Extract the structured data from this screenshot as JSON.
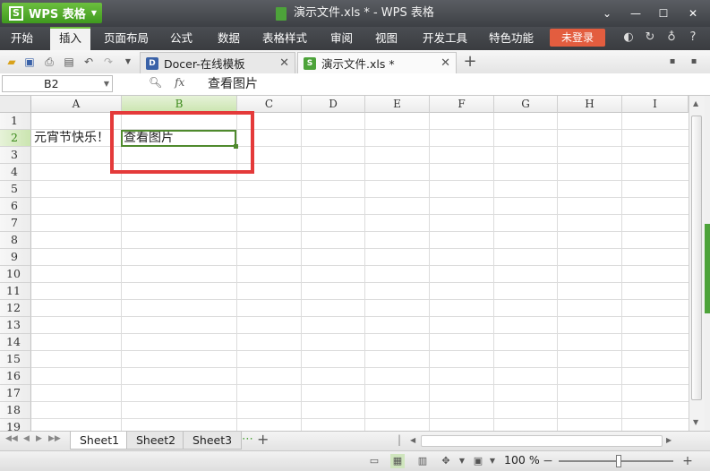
{
  "app": {
    "button_label": "WPS 表格",
    "logo_letter": "S",
    "window_title": "演示文件.xls * - WPS 表格"
  },
  "menu": {
    "items": [
      "开始",
      "插入",
      "页面布局",
      "公式",
      "数据",
      "表格样式",
      "审阅",
      "视图",
      "开发工具",
      "特色功能"
    ],
    "active": "插入",
    "login_label": "未登录"
  },
  "tabs": [
    {
      "label": "Docer-在线模板",
      "icon": "docer-icon",
      "active": false
    },
    {
      "label": "演示文件.xls *",
      "icon": "xls-icon",
      "active": true
    }
  ],
  "formula_bar": {
    "name_box": "B2",
    "fx_label": "fx",
    "content": "查看图片"
  },
  "sheet": {
    "columns": [
      "A",
      "B",
      "C",
      "D",
      "E",
      "F",
      "G",
      "H",
      "I"
    ],
    "rows": [
      "1",
      "2",
      "3",
      "4",
      "5",
      "6",
      "7",
      "8",
      "9",
      "10",
      "11",
      "12",
      "13",
      "14",
      "15",
      "16",
      "17",
      "18",
      "19"
    ],
    "selected_col": "B",
    "selected_row": "2",
    "cells": {
      "A2": "元宵节快乐！",
      "B2": "查看图片"
    }
  },
  "sheet_tabs": [
    "Sheet1",
    "Sheet2",
    "Sheet3"
  ],
  "active_sheet": "Sheet1",
  "status": {
    "zoom": "100 %"
  },
  "colors": {
    "accent_green": "#4da33a",
    "login_red": "#e35d3f",
    "highlight_red": "#e43a3a"
  }
}
